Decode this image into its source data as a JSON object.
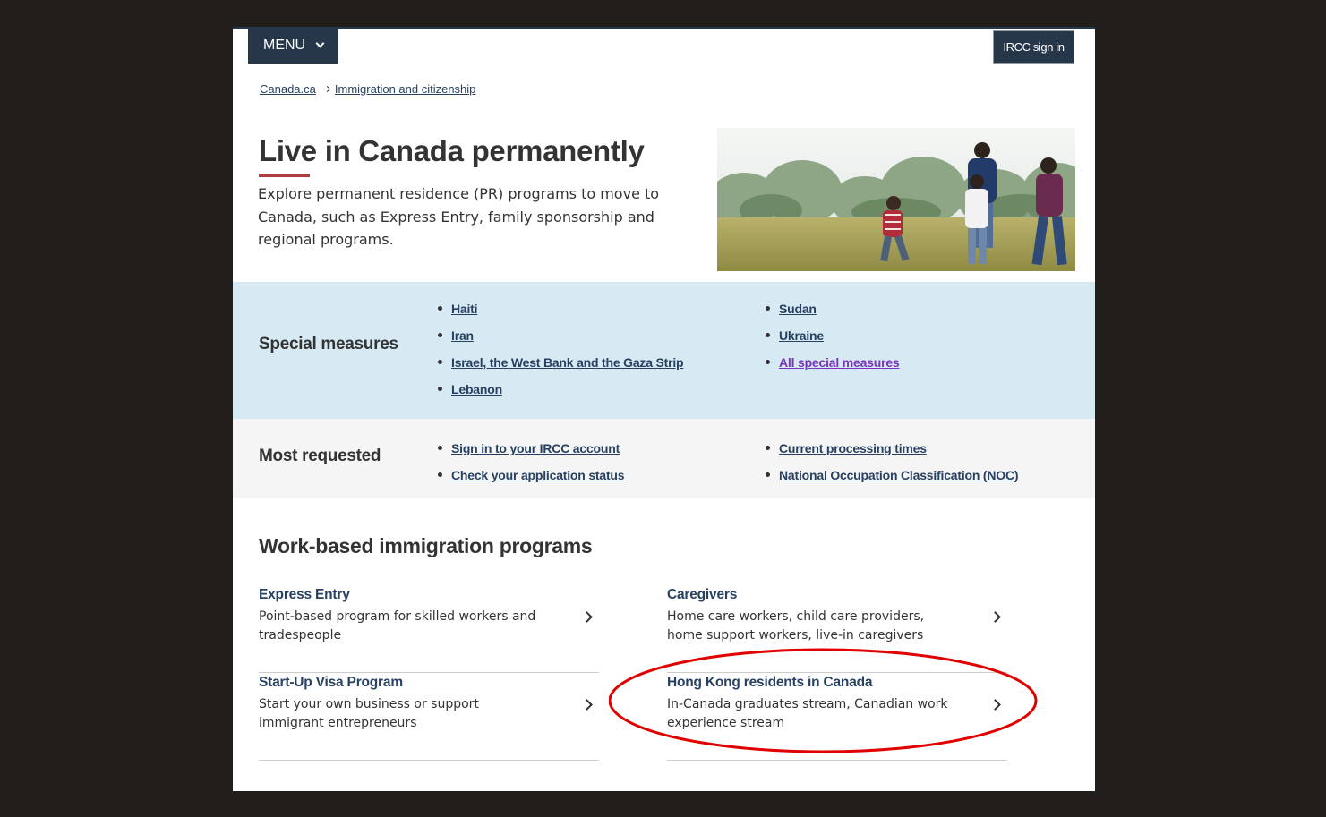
{
  "header": {
    "menu_label": "MENU",
    "signin_label": "IRCC sign in"
  },
  "breadcrumb": {
    "items": [
      "Canada.ca",
      "Immigration and citizenship"
    ]
  },
  "hero": {
    "title": "Live in Canada permanently",
    "intro": "Explore permanent residence (PR) programs to move to Canada, such as Express Entry, family sponsorship and regional programs."
  },
  "special_measures": {
    "heading": "Special measures",
    "col1": [
      "Haiti",
      "Iran",
      "Israel, the West Bank and the Gaza Strip",
      "Lebanon"
    ],
    "col2": [
      "Sudan",
      "Ukraine",
      "All special measures"
    ]
  },
  "most_requested": {
    "heading": "Most requested",
    "col1": [
      "Sign in to your IRCC account",
      "Check your application status"
    ],
    "col2": [
      "Current processing times",
      "National Occupation Classification (NOC)"
    ]
  },
  "programs": {
    "title": "Work-based immigration programs",
    "cards": [
      {
        "title": "Express Entry",
        "desc": "Point-based program for skilled workers and tradespeople"
      },
      {
        "title": "Caregivers",
        "desc": "Home care workers, child care providers, home support workers, live-in caregivers"
      },
      {
        "title": "Start-Up Visa Program",
        "desc": "Start your own business or support immigrant entrepreneurs"
      },
      {
        "title": "Hong Kong residents in Canada",
        "desc": "In-Canada graduates stream, Canadian work experience stream"
      }
    ]
  },
  "colors": {
    "brand_navy": "#26374a",
    "link": "#284162",
    "visited_link": "#7834bc",
    "title_rule": "#af3c43",
    "special_band": "#d7eaf4",
    "requested_band": "#f5f5f5",
    "annotation": "#e00000"
  },
  "icons": {
    "menu": "chevron-down-icon",
    "breadcrumb": "chevron-right-icon",
    "card": "chevron-right-icon"
  }
}
